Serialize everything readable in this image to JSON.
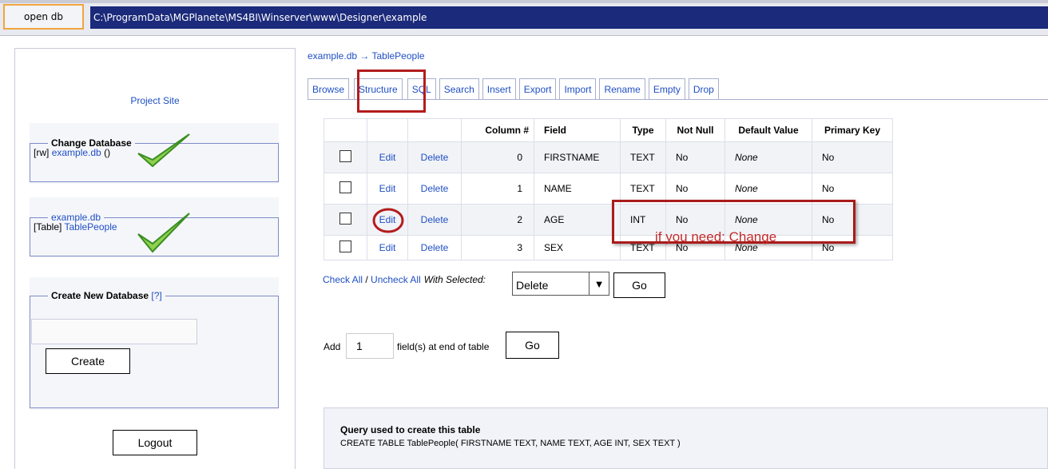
{
  "topbar": {
    "open_button": "open db",
    "path": "C:\\ProgramData\\MGPlanete\\MS4BI\\Winserver\\www\\Designer\\example"
  },
  "sidebar": {
    "project_site": "Project Site",
    "change_db": {
      "legend": "Change Database",
      "prefix": "[rw]",
      "db_link": "example.db",
      "suffix": "(",
      "suffix2": ")"
    },
    "tables": {
      "legend": "example.db",
      "prefix": "[Table]",
      "table_link": "TablePeople"
    },
    "create_db": {
      "legend": "Create New Database",
      "help": "[?]",
      "input_value": "",
      "button": "Create"
    },
    "logout": "Logout"
  },
  "main": {
    "breadcrumb": "example.db → TablePeople",
    "tabs": [
      "Browse",
      "Structure",
      "SQL",
      "Search",
      "Insert",
      "Export",
      "Import",
      "Rename",
      "Empty",
      "Drop"
    ],
    "active_tab": "Structure",
    "table": {
      "headers": [
        "",
        "",
        "",
        "Column #",
        "Field",
        "Type",
        "Not Null",
        "Default Value",
        "Primary Key"
      ],
      "rows": [
        {
          "edit": "Edit",
          "delete": "Delete",
          "col": "0",
          "field": "FIRSTNAME",
          "type": "TEXT",
          "notnull": "No",
          "default": "None",
          "pk": "No"
        },
        {
          "edit": "Edit",
          "delete": "Delete",
          "col": "1",
          "field": "NAME",
          "type": "TEXT",
          "notnull": "No",
          "default": "None",
          "pk": "No"
        },
        {
          "edit": "Edit",
          "delete": "Delete",
          "col": "2",
          "field": "AGE",
          "type": "INT",
          "notnull": "No",
          "default": "None",
          "pk": "No"
        },
        {
          "edit": "Edit",
          "delete": "Delete",
          "col": "3",
          "field": "SEX",
          "type": "TEXT",
          "notnull": "No",
          "default": "None",
          "pk": "No"
        }
      ]
    },
    "selection": {
      "check_all": "Check All",
      "separator": " / ",
      "uncheck_all": "Uncheck All",
      "with_selected": "With Selected:",
      "action": "Delete",
      "go": "Go"
    },
    "add_fields": {
      "label_before": "Add",
      "count": "1",
      "label_after": "field(s) at end of table",
      "go": "Go"
    },
    "query": {
      "title": "Query used to create this table",
      "sql": "CREATE TABLE TablePeople( FIRSTNAME TEXT, NAME TEXT, AGE INT, SEX TEXT )"
    },
    "annotation": "if you need: Change"
  },
  "colors": {
    "accent_border": "#f0a540",
    "path_bar": "#1b2a7a",
    "link": "#1f4fc4",
    "highlight": "#b31c1c",
    "check_green": "#4caf50"
  }
}
